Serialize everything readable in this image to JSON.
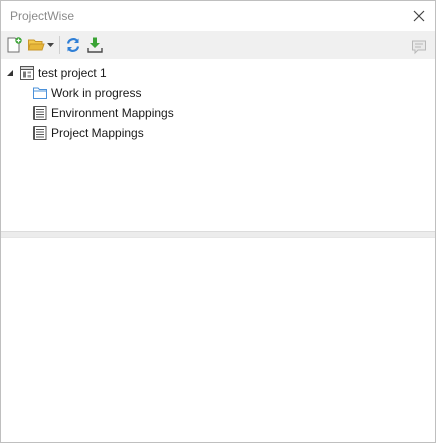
{
  "window": {
    "title": "ProjectWise"
  },
  "toolbar": {
    "buttons": [
      {
        "icon": "new-document-icon"
      },
      {
        "icon": "open-folder-icon"
      },
      {
        "icon": "dropdown-arrow-icon"
      },
      {
        "icon": "refresh-icon"
      },
      {
        "icon": "download-icon"
      },
      {
        "icon": "comment-icon"
      }
    ]
  },
  "tree": {
    "root": {
      "label": "test project 1",
      "expanded": true,
      "icon": "project-icon",
      "children": [
        {
          "label": "Work in progress",
          "icon": "folder-icon"
        },
        {
          "label": "Environment Mappings",
          "icon": "mapping-list-icon"
        },
        {
          "label": "Project Mappings",
          "icon": "mapping-list-icon"
        }
      ]
    }
  },
  "colors": {
    "accent_green": "#3aa335",
    "accent_blue": "#2f7fd6",
    "folder_yellow": "#e7b73a",
    "title_gray": "#8a8a8a"
  }
}
